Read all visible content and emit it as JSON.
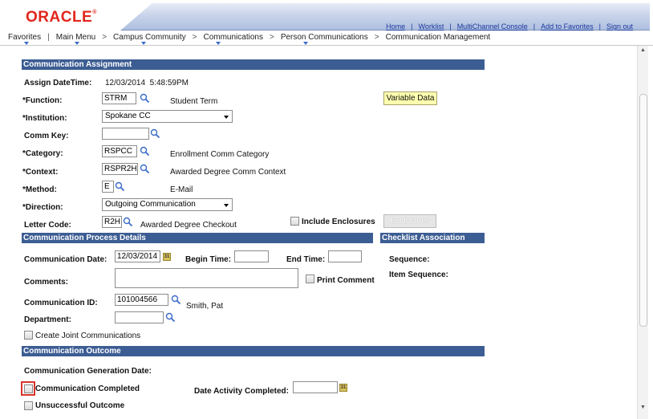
{
  "brand": {
    "logo_text": "ORACLE"
  },
  "top_links": [
    "Home",
    "Worklist",
    "MultiChannel Console",
    "Add to Favorites",
    "Sign out"
  ],
  "breadcrumb": [
    "Favorites",
    "Main Menu",
    "Campus Community",
    "Communications",
    "Person Communications",
    "Communication Management"
  ],
  "sections": {
    "assignment": "Communication Assignment",
    "process": "Communication Process Details",
    "checklist": "Checklist Association",
    "outcome": "Communication Outcome"
  },
  "assignment": {
    "assign_datetime_label": "Assign DateTime:",
    "assign_datetime_value": "12/03/2014  5:48:59PM",
    "function_label": "*Function:",
    "function_value": "STRM",
    "function_desc": "Student Term",
    "variable_data_button": "Variable Data",
    "institution_label": "*Institution:",
    "institution_value": "Spokane CC",
    "comm_key_label": "Comm Key:",
    "comm_key_value": "",
    "category_label": "*Category:",
    "category_value": "RSPCC",
    "category_desc": "Enrollment Comm Category",
    "context_label": "*Context:",
    "context_value": "RSPR2H",
    "context_desc": "Awarded Degree Comm Context",
    "method_label": "*Method:",
    "method_value": "E",
    "method_desc": "E-Mail",
    "direction_label": "*Direction:",
    "direction_value": "Outgoing Communication",
    "letter_code_label": "Letter Code:",
    "letter_code_value": "R2H",
    "letter_code_desc": "Awarded Degree Checkout",
    "include_enclosures_label": "Include Enclosures",
    "enclosures_button": "Enclosures"
  },
  "process": {
    "comm_date_label": "Communication Date:",
    "comm_date_value": "12/03/2014",
    "begin_time_label": "Begin Time:",
    "begin_time_value": "",
    "end_time_label": "End Time:",
    "end_time_value": "",
    "comments_label": "Comments:",
    "comments_value": "",
    "print_comment_label": "Print Comment",
    "comm_id_label": "Communication ID:",
    "comm_id_value": "101004566",
    "comm_id_name": "Smith, Pat",
    "department_label": "Department:",
    "department_value": "",
    "joint_comm_label": "Create Joint Communications"
  },
  "checklist": {
    "sequence_label": "Sequence:",
    "item_sequence_label": "Item Sequence:"
  },
  "outcome": {
    "generation_date_label": "Communication Generation Date:",
    "comm_completed_label": "Communication Completed",
    "date_activity_label": "Date Activity Completed:",
    "date_activity_value": "",
    "unsuccessful_label": "Unsuccessful Outcome"
  },
  "calendar_glyph": "31"
}
